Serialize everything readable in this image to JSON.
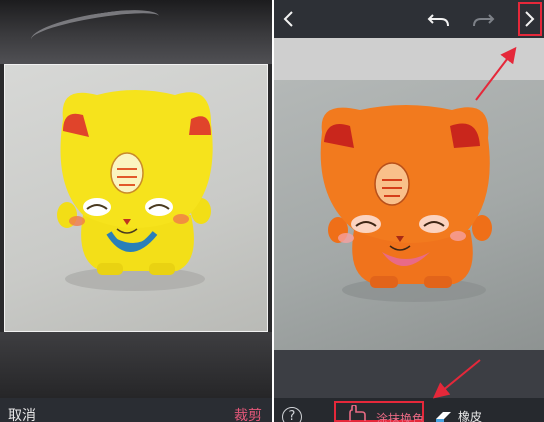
{
  "crop_screen": {
    "cancel_label": "取消",
    "crop_label": "裁剪",
    "photo_subject": "yellow-lucky-cat-figurine"
  },
  "editor_screen": {
    "toolbar": {
      "back_icon": "chevron-left-icon",
      "undo_icon": "undo-arrow-icon",
      "redo_icon": "redo-arrow-icon",
      "next_icon": "chevron-right-icon"
    },
    "photo_subject": "orange-recolored-lucky-cat-figurine",
    "tools": {
      "help_label": "?",
      "brush_label": "涂抹换色",
      "eraser_label": "橡皮"
    }
  },
  "colors": {
    "accent_pink": "#e5587a",
    "highlight_red": "#e5283a",
    "cat_yellow": "#f5e21a",
    "cat_orange": "#f0731c"
  }
}
